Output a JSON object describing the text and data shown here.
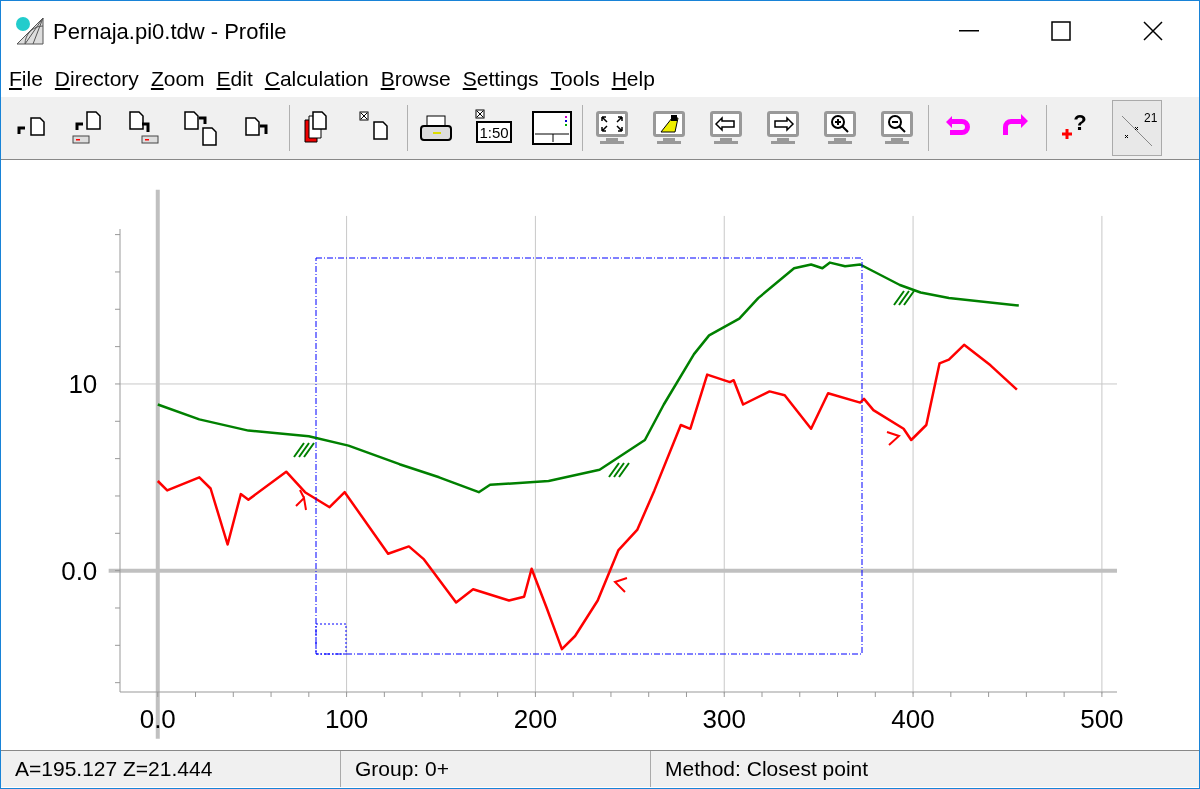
{
  "window": {
    "title": "Pernaja.pi0.tdw - Profile"
  },
  "menu": [
    {
      "label": "File"
    },
    {
      "label": "Directory"
    },
    {
      "label": "Zoom"
    },
    {
      "label": "Edit"
    },
    {
      "label": "Calculation"
    },
    {
      "label": "Browse"
    },
    {
      "label": "Settings"
    },
    {
      "label": "Tools"
    },
    {
      "label": "Help"
    }
  ],
  "toolbar": [
    [
      {
        "kind": "open",
        "selected": false
      },
      {
        "kind": "open-drive",
        "selected": false
      },
      {
        "kind": "save-drive",
        "selected": false
      },
      {
        "kind": "save-as",
        "selected": false
      },
      {
        "kind": "save",
        "selected": false
      }
    ],
    [
      {
        "kind": "copies",
        "selected": false
      },
      {
        "kind": "clear-page",
        "selected": false
      }
    ],
    [
      {
        "kind": "print",
        "selected": false
      },
      {
        "kind": "scale",
        "label": "1:50",
        "selected": false
      },
      {
        "kind": "layout",
        "selected": false
      }
    ],
    [
      {
        "kind": "fit",
        "selected": false
      },
      {
        "kind": "pan",
        "selected": false
      },
      {
        "kind": "back",
        "selected": false
      },
      {
        "kind": "forward",
        "selected": false
      },
      {
        "kind": "zoom-in",
        "selected": false
      },
      {
        "kind": "zoom-out",
        "selected": false
      }
    ],
    [
      {
        "kind": "undo",
        "selected": false
      },
      {
        "kind": "redo",
        "selected": false
      }
    ],
    [
      {
        "kind": "add-help",
        "label": "?",
        "selected": false
      },
      {
        "kind": "points",
        "label": "21",
        "selected": true
      }
    ]
  ],
  "chart_data": {
    "type": "line",
    "xlim": [
      -20,
      508
    ],
    "ylim": [
      -6.5,
      18.3
    ],
    "grid": true,
    "xticks": [
      {
        "value": 0,
        "label": "0.0"
      },
      100,
      200,
      300,
      400,
      500
    ],
    "yticks": [
      {
        "value": 0,
        "label": "0.0"
      },
      10
    ],
    "series": [
      {
        "color": "#008000",
        "x": [
          0,
          22,
          48,
          80,
          101,
          128,
          149,
          170,
          176,
          207,
          234,
          258,
          268,
          284,
          292,
          308,
          318,
          337,
          346,
          352,
          356,
          364,
          372,
          393,
          404,
          419,
          456
        ],
        "values": [
          8.9,
          8.1,
          7.5,
          7.2,
          6.7,
          5.7,
          5.0,
          4.2,
          4.6,
          4.8,
          5.4,
          7.0,
          8.9,
          11.6,
          12.6,
          13.5,
          14.6,
          16.2,
          16.4,
          16.2,
          16.5,
          16.3,
          16.4,
          15.3,
          14.9,
          14.6,
          14.2
        ]
      },
      {
        "color": "#ff0000",
        "x": [
          0,
          5,
          22,
          28,
          37,
          44,
          48,
          68,
          78,
          91,
          99,
          122,
          133,
          141,
          158,
          167,
          186,
          194,
          198,
          206,
          214,
          221,
          233,
          244,
          254,
          263,
          277,
          282,
          291,
          303,
          305,
          310,
          324,
          332,
          346,
          355,
          372,
          374,
          379,
          395,
          399,
          407,
          414,
          419,
          427,
          441,
          455
        ],
        "values": [
          4.8,
          4.3,
          5.0,
          4.4,
          1.4,
          4.1,
          3.8,
          5.3,
          4.2,
          3.4,
          4.2,
          0.9,
          1.3,
          0.6,
          -1.7,
          -1.0,
          -1.6,
          -1.4,
          0.1,
          -2.0,
          -4.2,
          -3.5,
          -1.6,
          1.1,
          2.2,
          4.3,
          7.8,
          7.6,
          10.5,
          10.1,
          10.2,
          8.9,
          9.6,
          9.4,
          7.6,
          9.5,
          9.0,
          9.2,
          8.6,
          7.6,
          7.0,
          7.8,
          11.1,
          11.3,
          12.1,
          11.0,
          9.7
        ]
      }
    ]
  },
  "status_bar": [
    "A=195.127  Z=21.444",
    "Group: 0+",
    "Method: Closest point"
  ]
}
